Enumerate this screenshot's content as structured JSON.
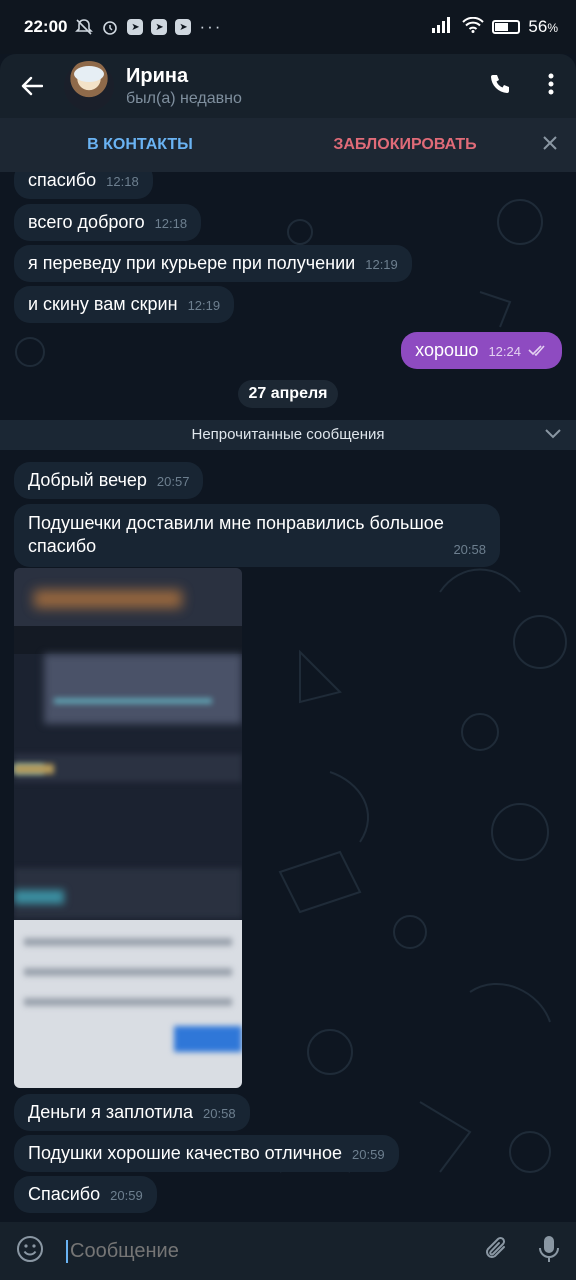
{
  "status_bar": {
    "time": "22:00",
    "battery": "56",
    "battery_level": 0.56
  },
  "header": {
    "name": "Ирина",
    "status": "был(а) недавно"
  },
  "action_bar": {
    "add_contact": "В КОНТАКТЫ",
    "block": "ЗАБЛОКИРОВАТЬ"
  },
  "messages_before": [
    {
      "text": "спасибо",
      "time": "12:18"
    },
    {
      "text": "всего доброго",
      "time": "12:18"
    },
    {
      "text": "я переведу при курьере при получении",
      "time": "12:19"
    },
    {
      "text": "и скину вам скрин",
      "time": "12:19"
    }
  ],
  "outgoing": {
    "text": "хорошо",
    "time": "12:24"
  },
  "date_separator": "27 апреля",
  "unread_label": "Непрочитанные сообщения",
  "messages_after": [
    {
      "text": "Добрый вечер",
      "time": "20:57"
    },
    {
      "text": "Подушечки доставили мне понравились большое спасибо",
      "time": "20:58"
    },
    {
      "text": "Деньги я заплотила",
      "time": "20:58"
    },
    {
      "text": "Подушки хорошие качество отличное",
      "time": "20:59"
    },
    {
      "text": "Спасибо",
      "time": "20:59"
    }
  ],
  "input": {
    "placeholder": "Сообщение"
  },
  "colors": {
    "accent": "#6ab3f3",
    "danger": "#e06b78",
    "outgoing_bubble": "#8e4bc1",
    "incoming_bubble": "#182533"
  }
}
